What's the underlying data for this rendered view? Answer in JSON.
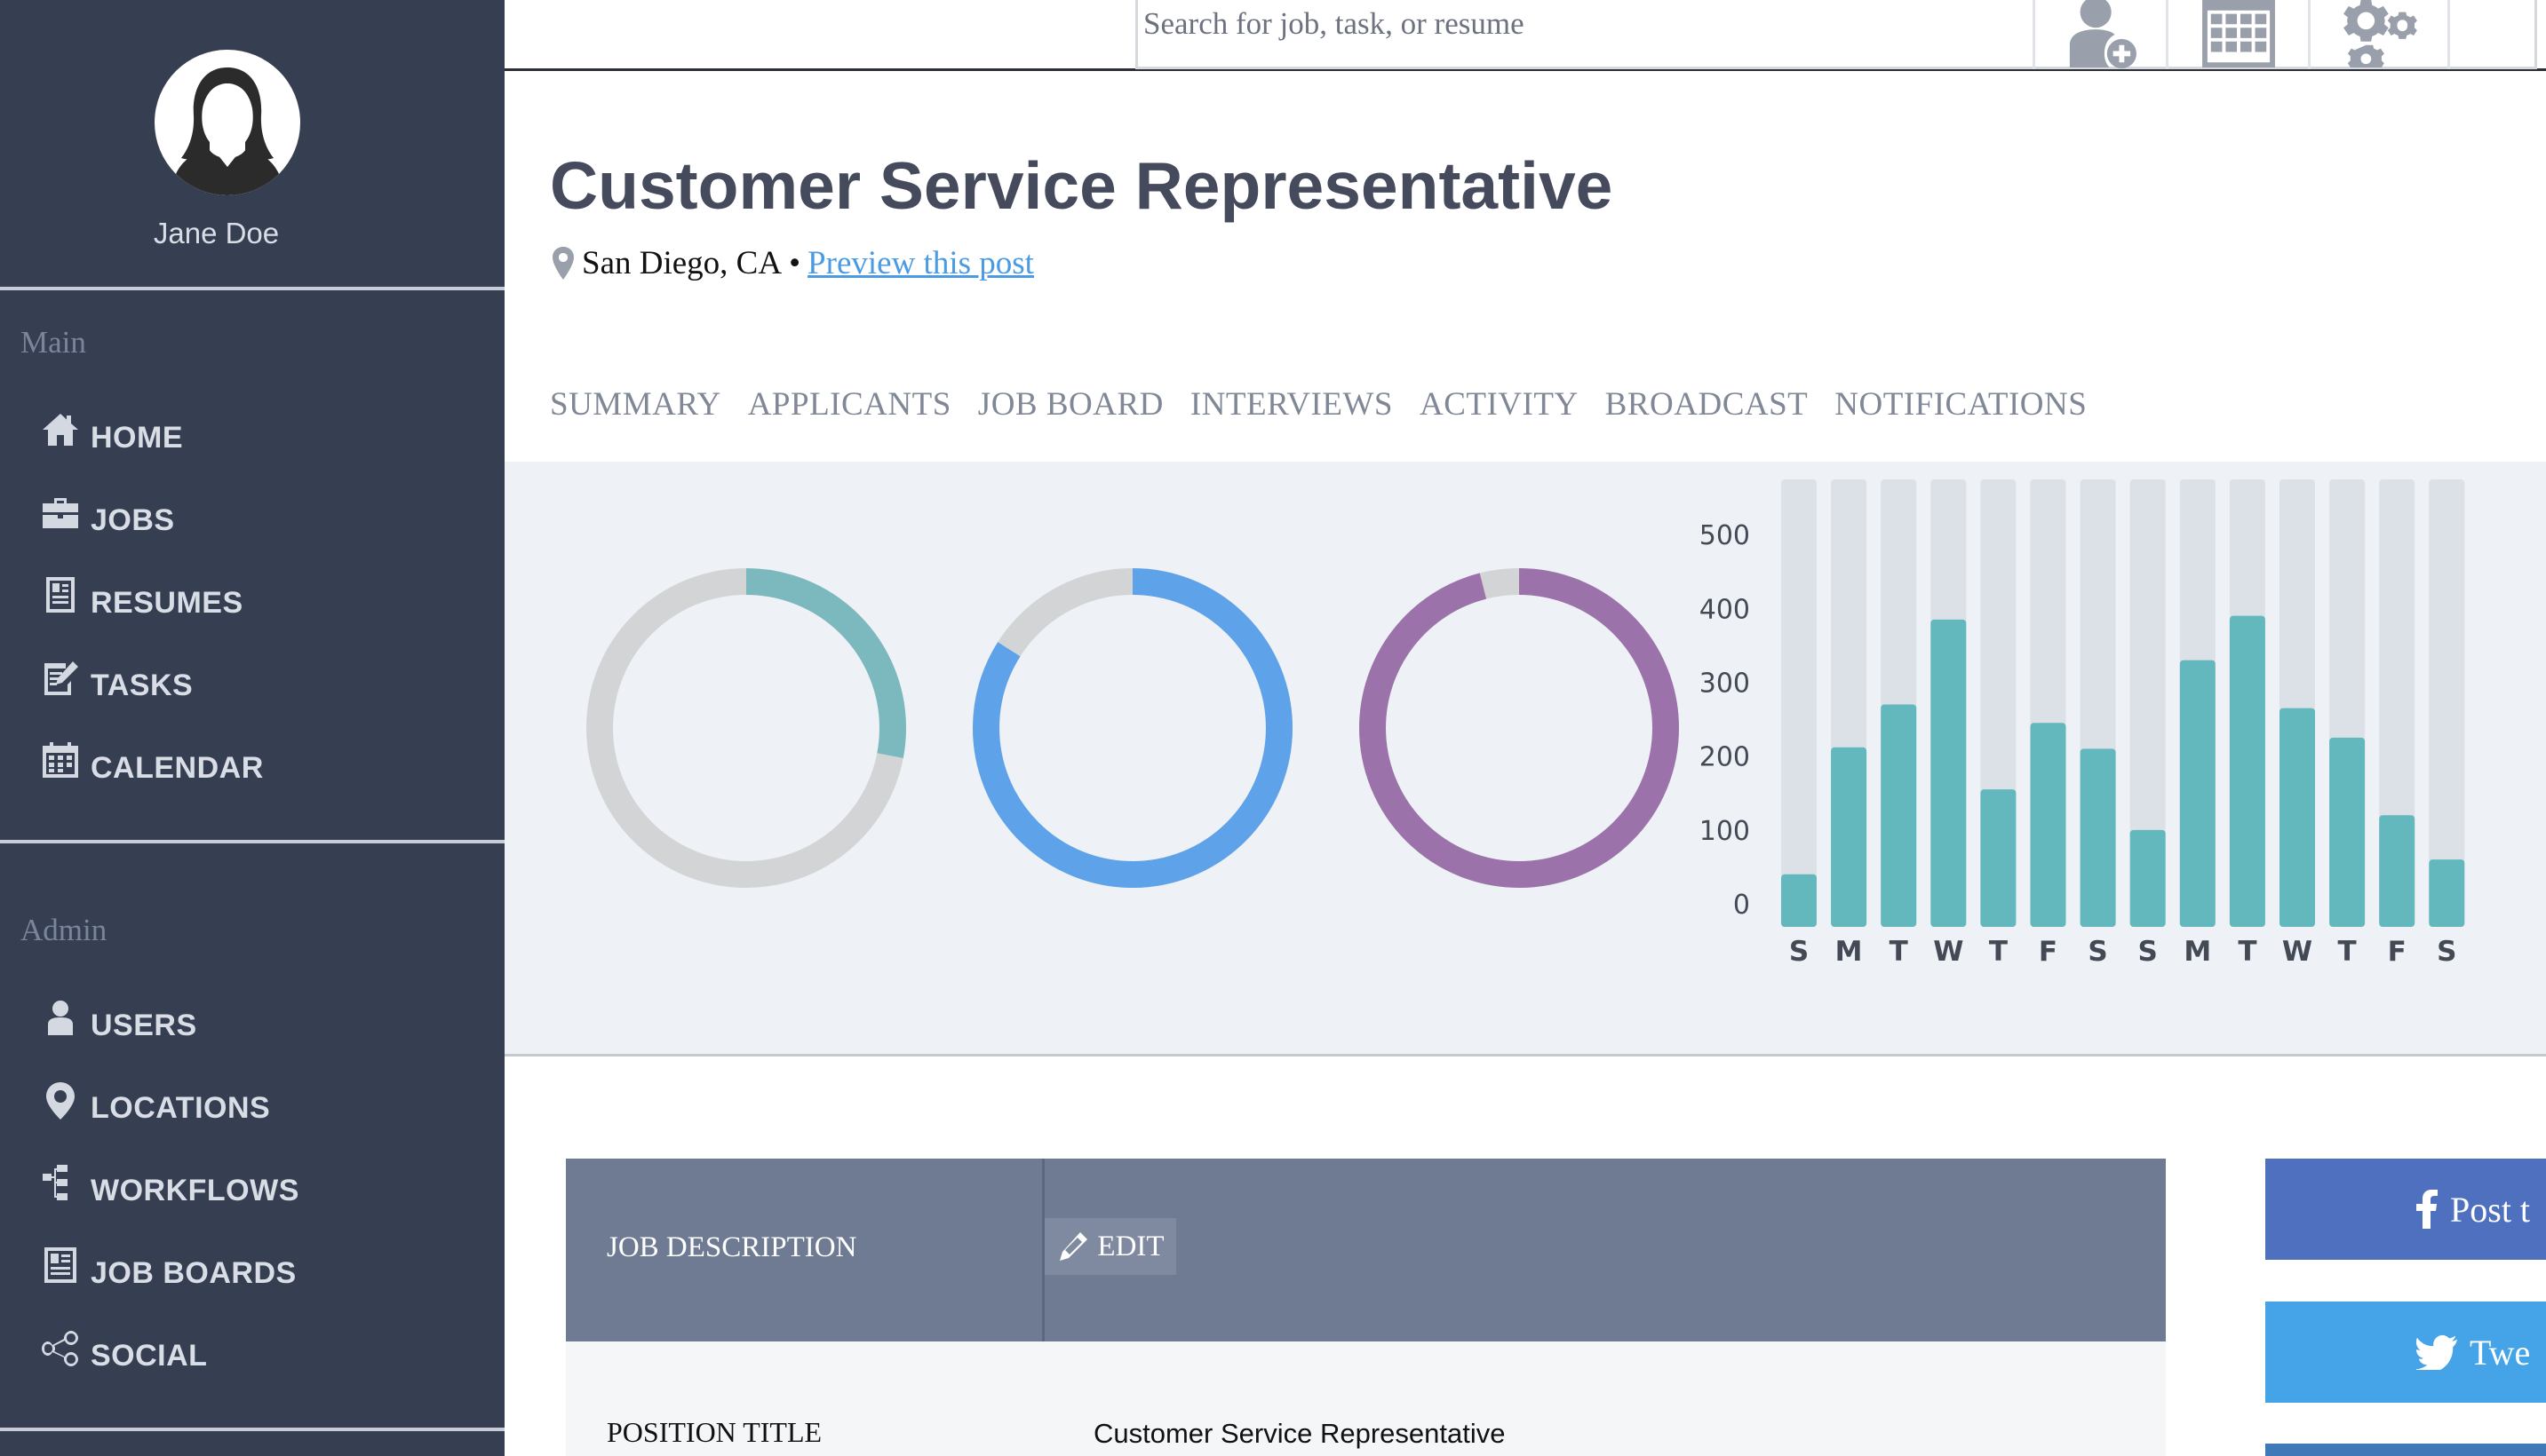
{
  "user": {
    "name": "Jane Doe"
  },
  "sidebar": {
    "main_label": "Main",
    "admin_label": "Admin",
    "main_items": [
      {
        "label": "HOME",
        "icon": "home-icon"
      },
      {
        "label": "JOBS",
        "icon": "briefcase-icon"
      },
      {
        "label": "RESUMES",
        "icon": "resume-icon"
      },
      {
        "label": "TASKS",
        "icon": "tasks-icon"
      },
      {
        "label": "CALENDAR",
        "icon": "calendar-icon"
      }
    ],
    "admin_items": [
      {
        "label": "USERS",
        "icon": "user-icon"
      },
      {
        "label": "LOCATIONS",
        "icon": "location-pin-icon"
      },
      {
        "label": "WORKFLOWS",
        "icon": "workflow-icon"
      },
      {
        "label": "JOB BOARDS",
        "icon": "job-board-icon"
      },
      {
        "label": "SOCIAL",
        "icon": "share-icon"
      }
    ]
  },
  "header": {
    "search_placeholder": "Search for job, task, or resume",
    "icons": [
      "add-user-icon",
      "calendar-icon",
      "settings-gears-icon"
    ]
  },
  "job": {
    "title": "Customer Service Representative",
    "location": "San Diego, CA",
    "bullet": "•",
    "preview_link": "Preview this post"
  },
  "tabs": [
    "SUMMARY",
    "APPLICANTS",
    "JOB BOARD",
    "INTERVIEWS",
    "ACTIVITY",
    "BROADCAST",
    "NOTIFICATIONS"
  ],
  "colors": {
    "sidebar_bg": "#363f51",
    "donut_track": "#d3d4d6",
    "donut_teal": "#7bb9bf",
    "donut_blue": "#5ea2ea",
    "donut_purple": "#9b72aa",
    "bar_fill": "#62b8bc",
    "bar_track": "#dce1e8",
    "facebook": "#4f6fbf",
    "twitter": "#45a3e8"
  },
  "donuts": [
    {
      "name": "donut-1",
      "fraction": 0.28,
      "color": "#7bb9bf"
    },
    {
      "name": "donut-2",
      "fraction": 0.84,
      "color": "#5ea2ea"
    },
    {
      "name": "donut-3",
      "fraction": 0.96,
      "color": "#9b72aa"
    }
  ],
  "chart_data": {
    "type": "bar",
    "categories": [
      "S",
      "M",
      "T",
      "W",
      "T",
      "F",
      "S",
      "S",
      "M",
      "T",
      "W",
      "T",
      "F",
      "S"
    ],
    "values": [
      40,
      212,
      270,
      385,
      155,
      245,
      210,
      100,
      330,
      390,
      265,
      225,
      120,
      60
    ],
    "ylim": [
      0,
      500
    ],
    "yticks": [
      "500",
      "400",
      "300",
      "200",
      "100",
      "0"
    ],
    "title": "",
    "xlabel": "",
    "ylabel": "",
    "grid": false
  },
  "job_description": {
    "header": "JOB DESCRIPTION",
    "edit_label": "EDIT",
    "field_label": "POSITION TITLE",
    "field_value": "Customer Service Representative"
  },
  "social": {
    "facebook_label": "Post t",
    "twitter_label": "Twe"
  }
}
